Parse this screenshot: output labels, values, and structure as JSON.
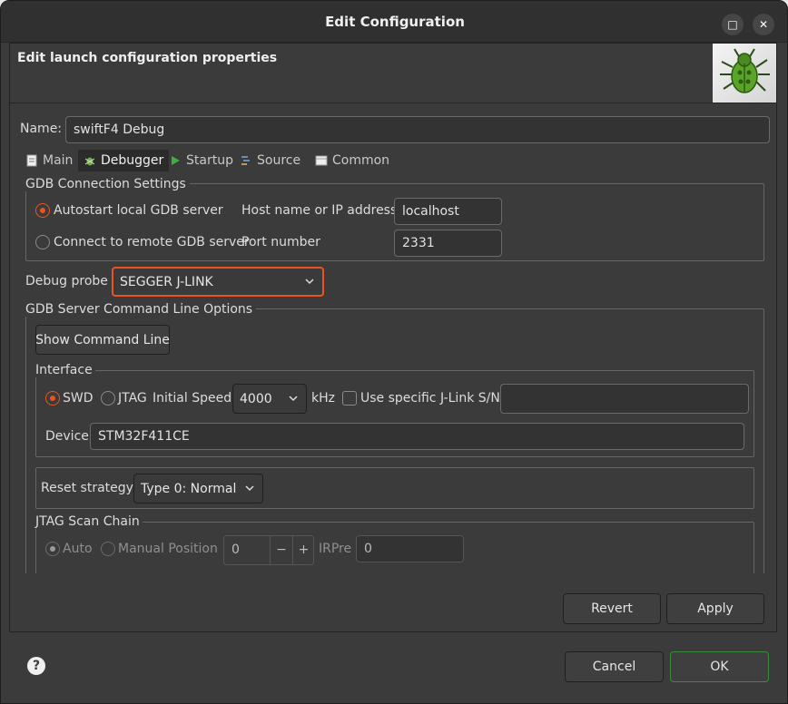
{
  "window": {
    "title": "Edit Configuration",
    "maximize_icon": "□",
    "close_icon": "✕"
  },
  "header": {
    "title": "Edit launch configuration properties"
  },
  "name_field": {
    "label": "Name:",
    "value": "swiftF4 Debug"
  },
  "tabs": [
    {
      "label": "Main",
      "icon": "document-icon"
    },
    {
      "label": "Debugger",
      "icon": "bug-icon",
      "active": true
    },
    {
      "label": "Startup",
      "icon": "play-icon"
    },
    {
      "label": "Source",
      "icon": "source-icon"
    },
    {
      "label": "Common",
      "icon": "common-icon"
    }
  ],
  "gdb_connection": {
    "title": "GDB Connection Settings",
    "autostart_label": "Autostart local GDB server",
    "remote_label": "Connect to remote GDB server",
    "host_label": "Host name or IP address",
    "host_value": "localhost",
    "port_label": "Port number",
    "port_value": "2331",
    "selected": "autostart"
  },
  "debug_probe": {
    "label": "Debug probe",
    "value": "SEGGER J-LINK"
  },
  "gdb_server": {
    "title": "GDB Server Command Line Options",
    "show_cmd_label": "Show Command Line",
    "interface_title": "Interface",
    "swd_label": "SWD",
    "jtag_label": "JTAG",
    "selected_interface": "SWD",
    "initial_speed_label": "Initial Speed",
    "initial_speed_value": "4000",
    "speed_unit": "kHz",
    "use_sn_label": "Use specific J-Link S/N",
    "use_sn_checked": false,
    "sn_value": "",
    "device_label": "Device",
    "device_value": "STM32F411CE",
    "reset_label": "Reset strategy",
    "reset_value": "Type 0: Normal",
    "jtag_scan_title": "JTAG Scan Chain",
    "auto_label": "Auto",
    "manual_label": "Manual Position",
    "position_value": "0",
    "minus": "−",
    "plus": "+",
    "irpre_label": "IRPre",
    "irpre_value": "0"
  },
  "buttons": {
    "revert": "Revert",
    "apply": "Apply",
    "cancel": "Cancel",
    "ok": "OK",
    "help": "?"
  },
  "colors": {
    "accent": "#e95420",
    "background": "#3b3b3b",
    "ok_border": "#3c8a3c"
  }
}
